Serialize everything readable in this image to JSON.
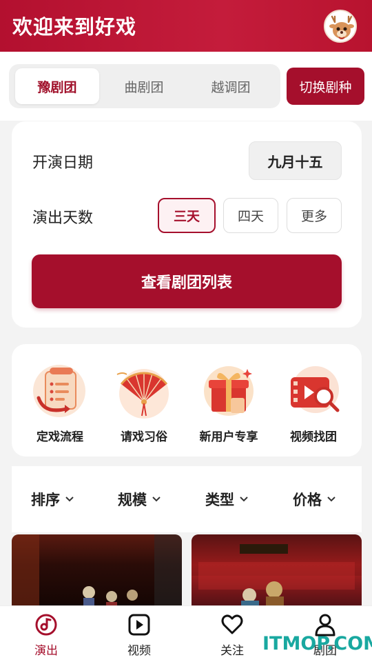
{
  "header": {
    "title": "欢迎来到好戏",
    "avatar_icon": "deer-avatar-icon"
  },
  "troupe_tabs": [
    {
      "label": "豫剧团",
      "active": true
    },
    {
      "label": "曲剧团",
      "active": false
    },
    {
      "label": "越调团",
      "active": false
    }
  ],
  "switch_button": "切换剧种",
  "filters": {
    "date_label": "开演日期",
    "date_value": "九月十五",
    "days_label": "演出天数",
    "days_options": [
      {
        "label": "三天",
        "active": true
      },
      {
        "label": "四天",
        "active": false
      },
      {
        "label": "更多",
        "active": false
      }
    ],
    "view_button": "查看剧团列表"
  },
  "features": [
    {
      "label": "定戏流程",
      "icon": "scroll-process-icon"
    },
    {
      "label": "请戏习俗",
      "icon": "fan-custom-icon"
    },
    {
      "label": "新用户专享",
      "icon": "gift-box-icon"
    },
    {
      "label": "视频找团",
      "icon": "video-search-icon"
    }
  ],
  "sort": [
    {
      "label": "排序"
    },
    {
      "label": "规模"
    },
    {
      "label": "类型"
    },
    {
      "label": "价格"
    }
  ],
  "bottom_nav": [
    {
      "label": "演出",
      "icon": "music-disc-icon",
      "active": true
    },
    {
      "label": "视频",
      "icon": "play-icon",
      "active": false
    },
    {
      "label": "关注",
      "icon": "heart-icon",
      "active": false
    },
    {
      "label": "剧团",
      "icon": "person-icon",
      "active": false
    }
  ],
  "watermark": "ITMOP.COM",
  "colors": {
    "brand": "#a50f2c",
    "header": "#c41c3b",
    "active_tab_text": "#a0102a"
  }
}
